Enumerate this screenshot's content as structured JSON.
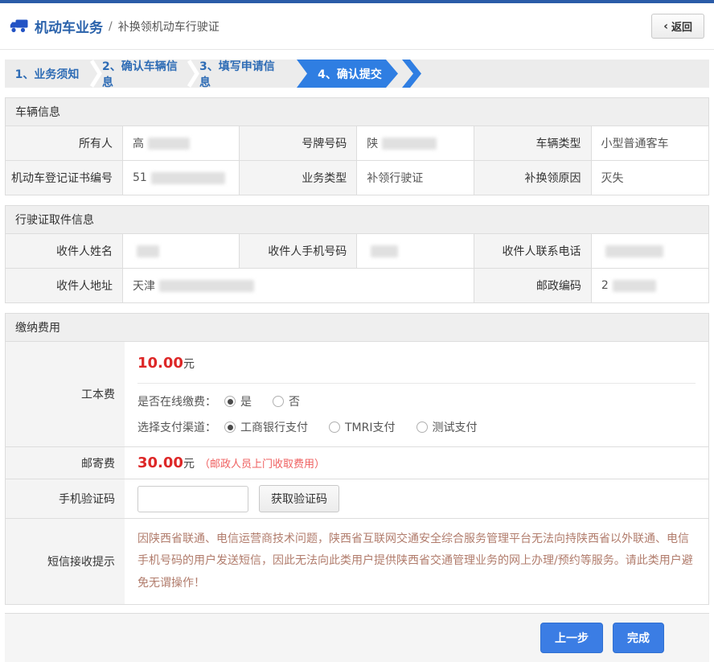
{
  "colors": {
    "top_border_blue": "#2b5ca8",
    "title_blue": "#2a62ab",
    "step_text_blue": "#2e6cb5",
    "active_step_blue": "#2f7ee2",
    "button_blue": "#3b7de4",
    "fee_red": "#dd2727",
    "note_red": "#ef6060",
    "sms_notice_color": "#b17c6c"
  },
  "header": {
    "title": "机动车业务",
    "divider": "/",
    "subtitle": "补换领机动车行驶证",
    "back_chevron": "‹",
    "back_label": "返回"
  },
  "steps": [
    {
      "label": "1、业务须知",
      "active": false
    },
    {
      "label": "2、确认车辆信息",
      "active": false
    },
    {
      "label": "3、填写申请信息",
      "active": false
    },
    {
      "label": "4、确认提交",
      "active": true
    }
  ],
  "vehicle_section": {
    "title": "车辆信息",
    "fields": [
      {
        "label": "所有人",
        "value": "高",
        "redacted": true
      },
      {
        "label": "号牌号码",
        "value": "陕",
        "redacted": true
      },
      {
        "label": "车辆类型",
        "value": "小型普通客车",
        "redacted": false
      },
      {
        "label": "机动车登记证书编号",
        "value": "51",
        "redacted": true
      },
      {
        "label": "业务类型",
        "value": "补领行驶证",
        "redacted": false
      },
      {
        "label": "补换领原因",
        "value": "灭失",
        "redacted": false
      }
    ]
  },
  "pickup_section": {
    "title": "行驶证取件信息",
    "fields": [
      {
        "label": "收件人姓名",
        "value": "",
        "redacted": true
      },
      {
        "label": "收件人手机号码",
        "value": "",
        "redacted": true
      },
      {
        "label": "收件人联系电话",
        "value": "",
        "redacted": true
      },
      {
        "label": "收件人地址",
        "value": "天津",
        "redacted": true
      },
      {
        "label": "邮政编码",
        "value": "2",
        "redacted": true
      }
    ]
  },
  "fees_section": {
    "title": "缴纳费用",
    "production_fee": {
      "label": "工本费",
      "amount": "10.00",
      "unit": "元",
      "online_question": "是否在线缴费：",
      "online_options": [
        {
          "label": "是",
          "selected": true
        },
        {
          "label": "否",
          "selected": false
        }
      ],
      "channel_question": "选择支付渠道：",
      "channel_options": [
        {
          "label": "工商银行支付",
          "selected": true
        },
        {
          "label": "TMRI支付",
          "selected": false
        },
        {
          "label": "测试支付",
          "selected": false
        }
      ]
    },
    "postage_fee": {
      "label": "邮寄费",
      "amount": "30.00",
      "unit": "元",
      "note": "（邮政人员上门收取费用）"
    },
    "sms_code": {
      "label": "手机验证码",
      "input_value": "",
      "button_label": "获取验证码"
    },
    "sms_notice": {
      "label": "短信接收提示",
      "text": "因陕西省联通、电信运营商技术问题，陕西省互联网交通安全综合服务管理平台无法向持陕西省以外联通、电信手机号码的用户发送短信，因此无法向此类用户提供陕西省交通管理业务的网上办理/预约等服务。请此类用户避免无谓操作！"
    }
  },
  "footer": {
    "prev_button": "上一步",
    "finish_button": "完成"
  }
}
